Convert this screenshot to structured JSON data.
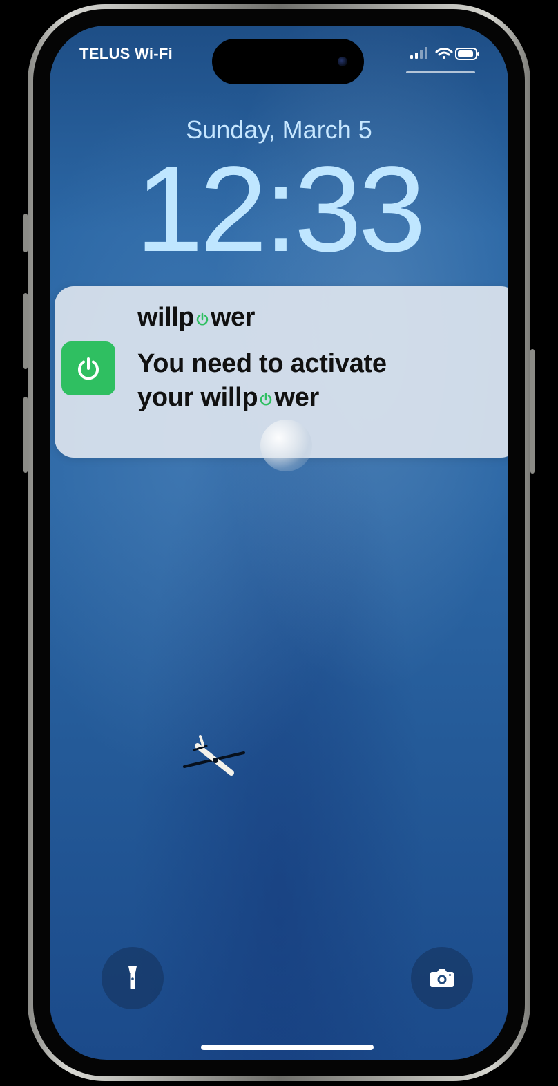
{
  "status_bar": {
    "carrier": "TELUS Wi-Fi",
    "icons": [
      "signal-icon",
      "wifi-icon",
      "battery-icon"
    ]
  },
  "lock_screen": {
    "date": "Sunday, March 5",
    "time": "12:33"
  },
  "notification": {
    "app_name_prefix": "willp",
    "app_name_suffix": "wer",
    "message_line1": "You need to activate",
    "message_line2_prefix": "your willp",
    "message_line2_suffix": "wer",
    "icon": "power-icon",
    "accent_color": "#2fbf61"
  },
  "controls": {
    "flashlight_icon": "flashlight-icon",
    "camera_icon": "camera-icon"
  },
  "colors": {
    "sky_blue": "#2d68a6",
    "clock_blue": "#bfe6ff",
    "notification_background": "#dce4ee",
    "brand_green": "#2fbf61"
  }
}
